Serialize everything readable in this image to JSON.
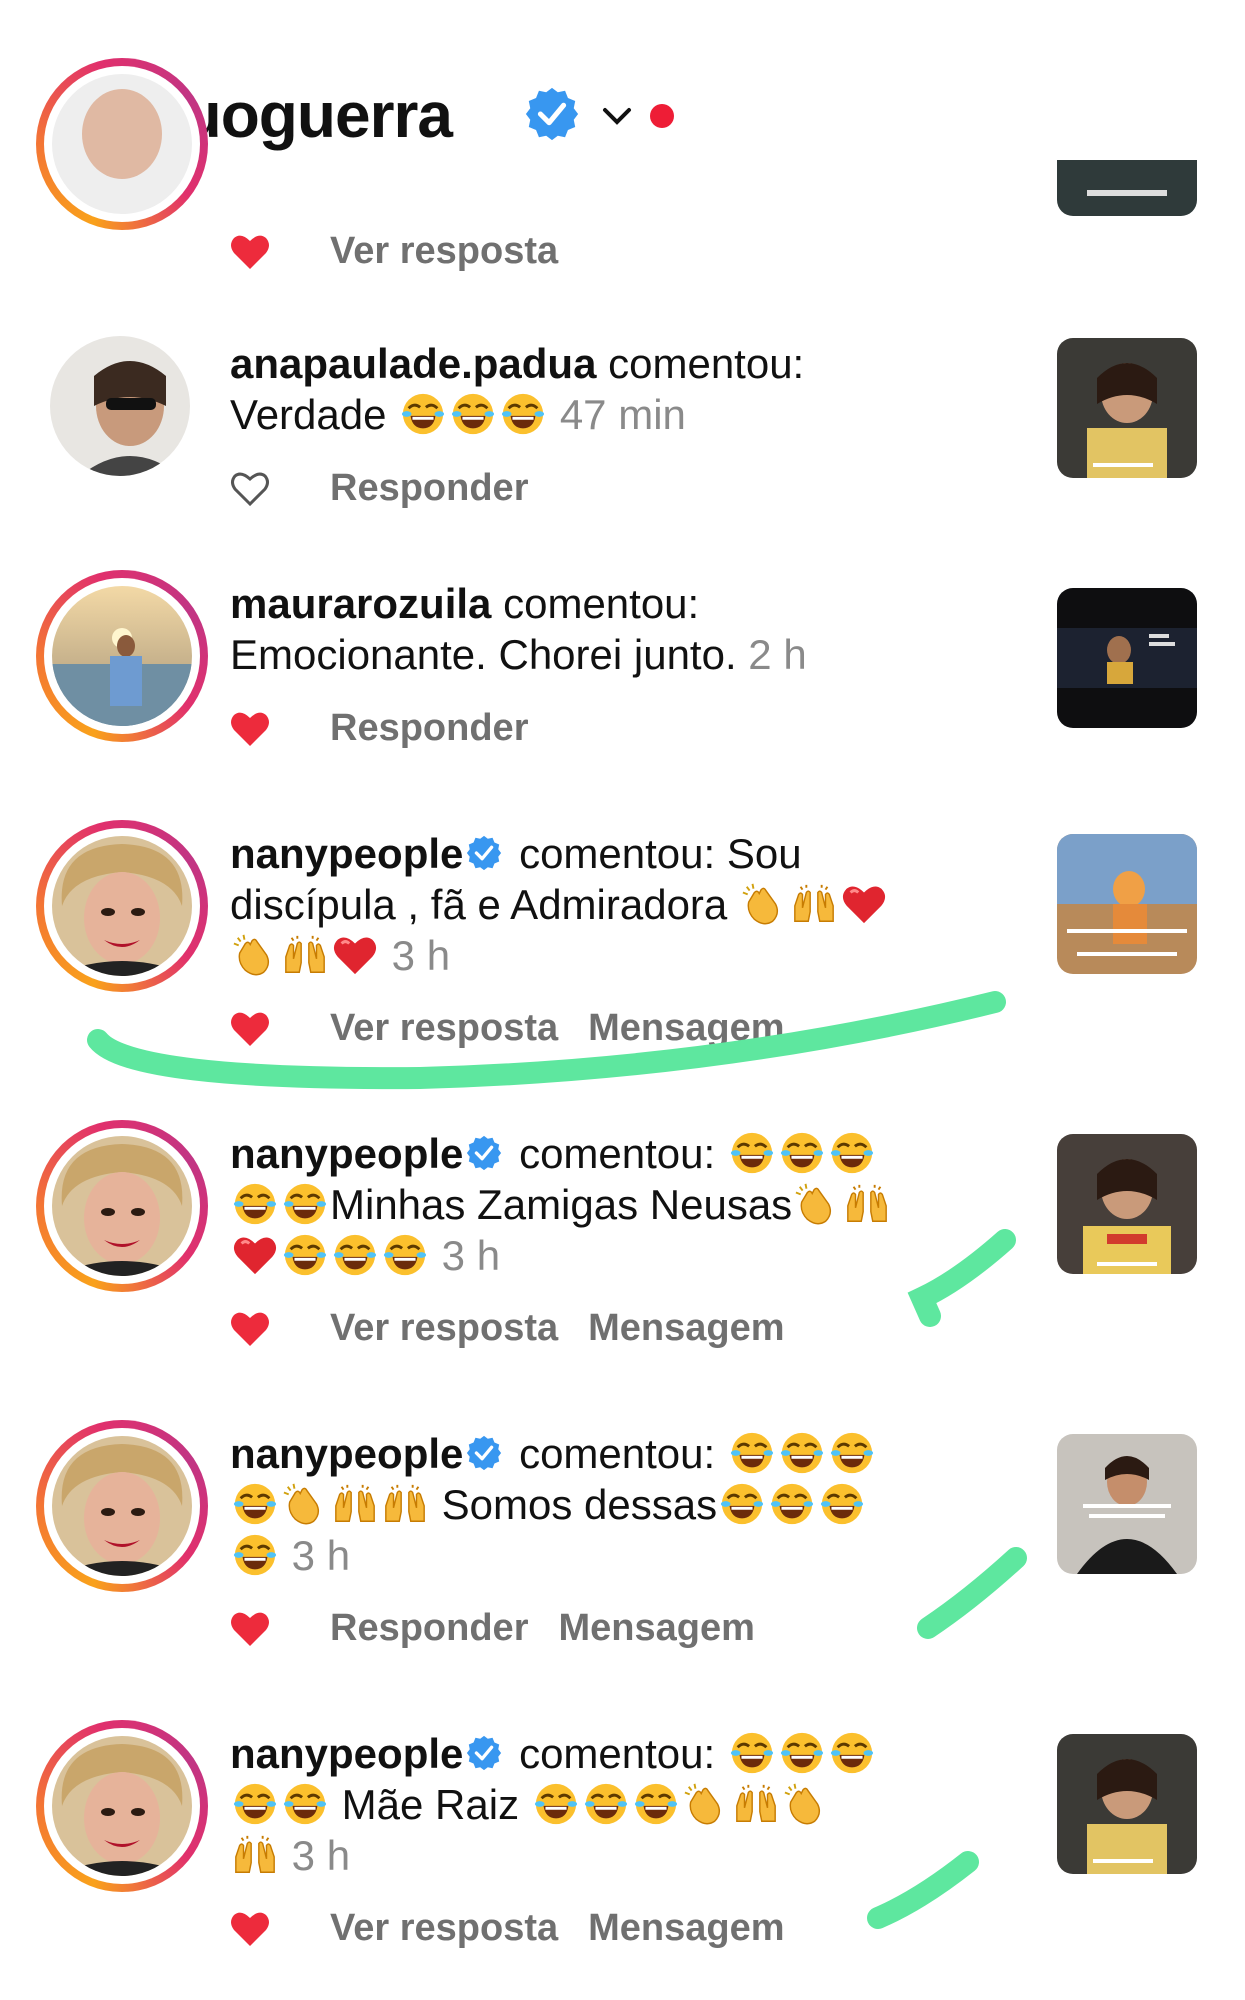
{
  "header": {
    "title": "euoguerra"
  },
  "colors": {
    "verified": "#3897f0",
    "heart": "#ed2b3c",
    "highlight": "#5ee79f",
    "notif_dot": "#ee1d36"
  },
  "partial_row": {
    "action": "Ver resposta"
  },
  "comments": [
    {
      "username": "anapaulade.padua",
      "verb": "comentou:",
      "text_before": "Verdade",
      "emojis": [
        "laugh-cry",
        "laugh-cry",
        "laugh-cry"
      ],
      "time": "47 min",
      "liked": false,
      "actions": [
        "Responder"
      ]
    },
    {
      "username": "maurarozuila",
      "verb": "comentou:",
      "text_before": "Emocionante. Chorei junto.",
      "time": "2 h",
      "liked": true,
      "actions": [
        "Responder"
      ]
    },
    {
      "username": "nanypeople",
      "verified": true,
      "verb": "comentou: Sou",
      "text_before": "discípula , fã e Admiradora",
      "time": "3 h",
      "liked": true,
      "actions": [
        "Ver resposta",
        "Mensagem"
      ]
    },
    {
      "username": "nanypeople",
      "verified": true,
      "verb": "comentou:",
      "text_before": "Minhas Zamigas Neusas",
      "time": "3 h",
      "liked": true,
      "actions": [
        "Ver resposta",
        "Mensagem"
      ]
    },
    {
      "username": "nanypeople",
      "verified": true,
      "verb": "comentou:",
      "text_before": "Somos dessas",
      "time": "3 h",
      "liked": true,
      "actions": [
        "Responder",
        "Mensagem"
      ]
    },
    {
      "username": "nanypeople",
      "verified": true,
      "verb": "comentou:",
      "text_before": "Mãe Raiz",
      "time": "3 h",
      "liked": true,
      "actions": [
        "Ver resposta",
        "Mensagem"
      ]
    }
  ]
}
